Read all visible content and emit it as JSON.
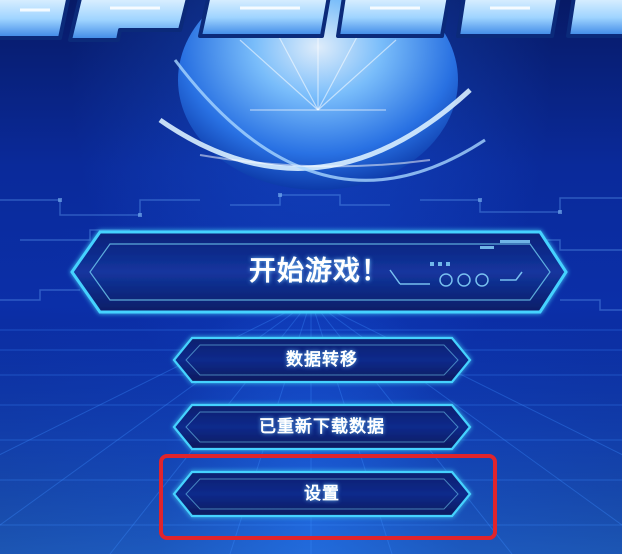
{
  "menu": {
    "start_label": "开始游戏！",
    "transfer_label": "数据转移",
    "redownload_label": "已重新下载数据",
    "settings_label": "设置"
  },
  "colors": {
    "accent": "#45d2ff",
    "highlight_frame": "#e0242c",
    "background_dark": "#020a2e",
    "background_mid": "#0b2fa8"
  },
  "icons": {
    "logo": "game-logo-emblem",
    "orb": "glowing-orb"
  }
}
